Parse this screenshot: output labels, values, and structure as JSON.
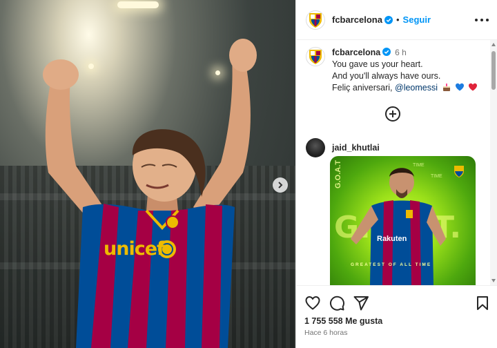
{
  "post": {
    "account": "fcbarcelona",
    "follow_label": "Seguir",
    "separator": "•"
  },
  "caption": {
    "account": "fcbarcelona",
    "time": "6 h",
    "line1": "You gave us your heart.",
    "line2": "And you'll always have ours.",
    "line3_prefix": "Feliç aniversari,",
    "mention": "@leomessi",
    "emojis": [
      "cake-icon",
      "blue-heart-icon",
      "red-heart-icon"
    ]
  },
  "comments": [
    {
      "user": "jaid_khutlai",
      "image_text": {
        "goat_vertical": "G.O.A.T",
        "time_a": "TIME",
        "time_b": "TIME",
        "big": "G.O.A.T.",
        "sponsor": "Rakuten",
        "tagline": "GREATEST OF ALL TIME"
      }
    }
  ],
  "footer": {
    "likes": "1 755 558 Me gusta",
    "posted": "Hace 6 horas"
  },
  "colors": {
    "accent": "#0095f6",
    "mention": "#00376b",
    "barca_blue": "#004d98",
    "barca_red": "#a50044",
    "barca_gold": "#edbb00"
  },
  "media": {
    "shirt_text": "unicef"
  }
}
